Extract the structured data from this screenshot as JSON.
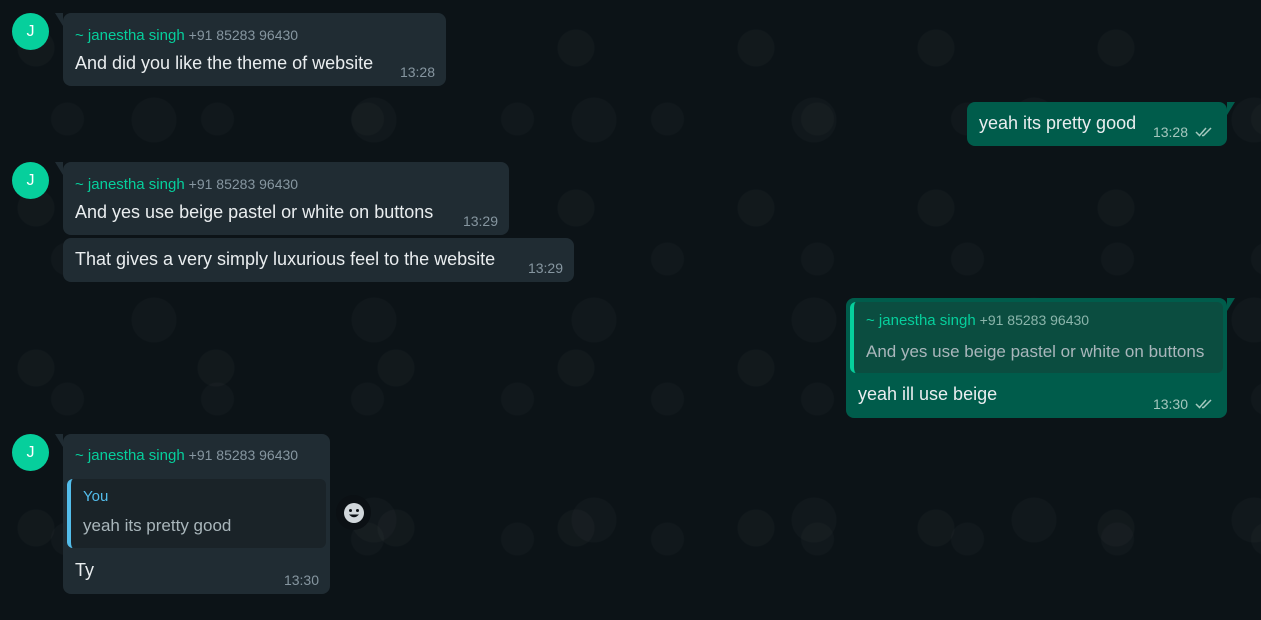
{
  "messages": {
    "m1": {
      "avatar": "J",
      "sender": "~ janestha singh",
      "phone": "+91 85283 96430",
      "text": "And did you like the theme of website",
      "time": "13:28"
    },
    "m2": {
      "text": "yeah its pretty good",
      "time": "13:28",
      "status": "read"
    },
    "m3": {
      "avatar": "J",
      "sender": "~ janestha singh",
      "phone": "+91 85283 96430",
      "text": "And yes use beige pastel or white on buttons",
      "time": "13:29"
    },
    "m4": {
      "text": "That gives a very simply luxurious feel to the website",
      "time": "13:29"
    },
    "m5": {
      "quote": {
        "sender": "~ janestha singh",
        "phone": "+91 85283 96430",
        "text": "And yes use beige pastel or white on buttons"
      },
      "text": "yeah ill use beige",
      "time": "13:30",
      "status": "read"
    },
    "m6": {
      "avatar": "J",
      "sender": "~ janestha singh",
      "phone": "+91 85283 96430",
      "quote": {
        "sender": "You",
        "text": "yeah its pretty good"
      },
      "text": "Ty",
      "time": "13:30"
    }
  },
  "icons": {
    "read_receipt": "double-check-icon",
    "react": "emoji-smile-icon"
  },
  "colors": {
    "background": "#0c1317",
    "incoming": "#202c33",
    "outgoing": "#005c4b",
    "accent": "#06cf9c",
    "quote_you": "#53bdeb"
  }
}
